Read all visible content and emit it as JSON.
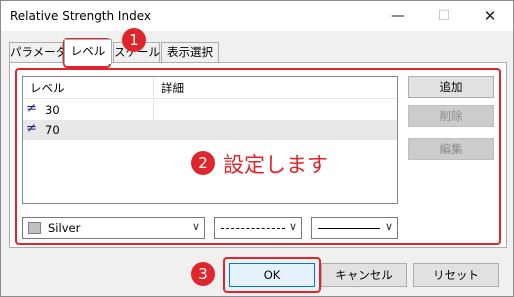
{
  "window": {
    "title": "Relative Strength Index",
    "controls": {
      "minimize": "—",
      "maximize": "☐",
      "close": "✕"
    }
  },
  "tabs": [
    {
      "label": "パラメータ",
      "active": false
    },
    {
      "label": "レベル",
      "active": true
    },
    {
      "label": "スケール",
      "active": false
    },
    {
      "label": "表示選択",
      "active": false
    }
  ],
  "levels_table": {
    "columns": [
      "レベル",
      "詳細"
    ],
    "rows": [
      {
        "icon": "level-line-icon",
        "value": "30",
        "detail": ""
      },
      {
        "icon": "level-line-icon",
        "value": "70",
        "detail": ""
      }
    ]
  },
  "side_buttons": {
    "add": "追加",
    "delete": "削除",
    "edit": "編集"
  },
  "style": {
    "color_name": "Silver",
    "color_hex": "#c0c0c0",
    "line_style": "dashed",
    "line_width": "thin"
  },
  "annotations": {
    "badge_1": "1",
    "badge_2": "2",
    "badge_3": "3",
    "note": "設定します",
    "accent_color": "#e0262d"
  },
  "footer": {
    "ok": "OK",
    "cancel": "キャンセル",
    "reset": "リセット"
  }
}
